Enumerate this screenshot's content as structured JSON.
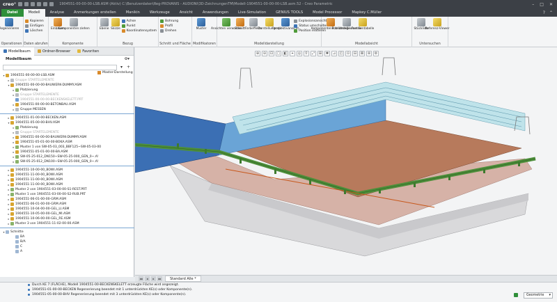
{
  "titlebar": {
    "logo": "creo°",
    "title": "1904551-00-00-00-LSB.ASM (Aktiv) C:\\Benutzerdaten\\Reg-PROVANIS - AUDIONI\\3D-ZeichnungenTM\\Modell-1904551-00-00-00-LSB.asm.52 - Creo Parametric",
    "controls": [
      "–",
      "□",
      "✕"
    ]
  },
  "tabs": [
    "Datei",
    "Modell",
    "Analyse",
    "Anmerkungen erstellen",
    "Manikin",
    "Werkzeuge",
    "Ansicht",
    "Anwendungen",
    "Live-Simulation",
    "GENIUS TOOLS",
    "Model Processor",
    "Mapkey C.Müller"
  ],
  "ribbon_groups": [
    {
      "label": "Operationen",
      "buttons": [
        "Regenerieren"
      ],
      "small": []
    },
    {
      "label": "Daten abrufen",
      "buttons": [],
      "small": [
        "Kopieren",
        "Einfügen",
        "Löschen"
      ]
    },
    {
      "label": "Komponente",
      "buttons": [
        "Einbauen",
        "Komponenten ziehen"
      ],
      "small": []
    },
    {
      "label": "Bezug",
      "buttons": [
        "Ebene",
        "Skizze"
      ],
      "small": [
        "Achse",
        "Punkt",
        "Koordinatensystem"
      ]
    },
    {
      "label": "Schnitt und Fläche",
      "buttons": [],
      "small": [
        "Bohrung",
        "Profil",
        "Drehen"
      ]
    },
    {
      "label": "Modifikatoren",
      "buttons": [
        "Muster"
      ],
      "small": []
    },
    {
      "label": "Modelldarstellung",
      "buttons": [
        "Ansichten verwalten",
        "Schnitt",
        "Farbeffekte",
        "Darstellungsstil",
        "Perspektivansicht"
      ],
      "small": [
        "Explosionsansicht",
        "Status umschalten",
        "Position editieren"
      ]
    },
    {
      "label": "Modellabsicht",
      "buttons": [
        "Komponentenschnittstelle",
        "Publizieregeometrie",
        "Familientabelle"
      ],
      "small": []
    },
    {
      "label": "Untersuchen",
      "buttons": [
        "Stückliste",
        "Referenz-Viewer"
      ],
      "small": []
    }
  ],
  "panel": {
    "tabs": [
      "Modellbaum",
      "Ordner-Browser",
      "Favoriten"
    ],
    "title": "Modellbaum",
    "search_placeholder": "",
    "column_header": "Master-Darstellung"
  },
  "tree": [
    {
      "text": "1904551-00-00-00-LSB.ASM",
      "icon": "asm",
      "indent": 0,
      "exp": "▾",
      "dim": false,
      "sel": false
    },
    {
      "text": "Gruppe STARTELEMENTE",
      "icon": "grp",
      "indent": 1,
      "exp": "▸",
      "dim": true,
      "sel": false
    },
    {
      "text": "1904551-00-00-00-BAUWERK-DUMMY.ASM",
      "icon": "asm",
      "indent": 1,
      "exp": "▾",
      "dim": false,
      "sel": false
    },
    {
      "text": "Platzierung",
      "icon": "feat",
      "indent": 2,
      "exp": "▸",
      "dim": false,
      "sel": false
    },
    {
      "text": "Gruppe STARTELEMENTE",
      "icon": "grp",
      "indent": 2,
      "exp": "▸",
      "dim": true,
      "sel": false
    },
    {
      "text": "1904551-00-00-00-BECKENSKELETT.PRT",
      "icon": "prt",
      "indent": 2,
      "exp": "",
      "dim": true,
      "sel": false
    },
    {
      "text": "1904551-00-00-00-BETONBAU.ASM",
      "icon": "asm",
      "indent": 2,
      "exp": "▸",
      "dim": false,
      "sel": false
    },
    {
      "text": "Gruppe MESSEN",
      "icon": "grp",
      "indent": 2,
      "exp": "▸",
      "dim": false,
      "sel": false
    },
    {
      "text": "sep",
      "icon": "",
      "indent": 0,
      "exp": "",
      "dim": false,
      "sel": false
    },
    {
      "text": "1904551-01-00-00-BECKEN.ASM",
      "icon": "asm",
      "indent": 1,
      "exp": "▸",
      "dim": false,
      "sel": false
    },
    {
      "text": "1904551-05-00-00-BHV.ASM",
      "icon": "asm",
      "indent": 1,
      "exp": "▾",
      "dim": false,
      "sel": false
    },
    {
      "text": "Platzierung",
      "icon": "feat",
      "indent": 2,
      "exp": "▸",
      "dim": false,
      "sel": false
    },
    {
      "text": "Gruppe STARTELEMENTE",
      "icon": "grp",
      "indent": 2,
      "exp": "▸",
      "dim": true,
      "sel": false
    },
    {
      "text": "1904551-00-00-00-BAUWERK-DUMMY.ASM",
      "icon": "asm",
      "indent": 2,
      "exp": "▸",
      "dim": false,
      "sel": false
    },
    {
      "text": "1904551-05-01-00-00-BOKA.ASM",
      "icon": "asm",
      "indent": 2,
      "exp": "▸",
      "dim": false,
      "sel": false
    },
    {
      "text": "Muster 1 von SW-05-03_003_BBF125~SW-05-03-00",
      "icon": "feat",
      "indent": 2,
      "exp": "▸",
      "dim": false,
      "sel": false
    },
    {
      "text": "1904551-05-01-00-00-BA.ASM",
      "icon": "asm",
      "indent": 2,
      "exp": "▸",
      "dim": false,
      "sel": false
    },
    {
      "text": "SW-05-25-012_DN150~SW-05-25-000_GEN_0~.A!",
      "icon": "feat",
      "indent": 2,
      "exp": "▸",
      "dim": false,
      "sel": false
    },
    {
      "text": "SW-05-25-012_DN100~SW-05-25-000_GEN_0~.A!",
      "icon": "feat",
      "indent": 2,
      "exp": "▸",
      "dim": false,
      "sel": false
    },
    {
      "text": "sep",
      "icon": "",
      "indent": 0,
      "exp": "",
      "dim": false,
      "sel": false
    },
    {
      "text": "1904551-10-00-00_BOWI.ASM",
      "icon": "asm",
      "indent": 1,
      "exp": "▸",
      "dim": false,
      "sel": false
    },
    {
      "text": "1904551-11-00-00_BOWI.ASM",
      "icon": "asm",
      "indent": 1,
      "exp": "▸",
      "dim": false,
      "sel": false
    },
    {
      "text": "1904551-11-00-00_BOWI.ASM",
      "icon": "asm",
      "indent": 1,
      "exp": "▸",
      "dim": false,
      "sel": false
    },
    {
      "text": "1904551-11-00-00_BOWI.ASM",
      "icon": "asm",
      "indent": 1,
      "exp": "▸",
      "dim": false,
      "sel": false
    },
    {
      "text": "Muster 2 von 1904551-03-00-00-S1-REST.PRT",
      "icon": "feat",
      "indent": 1,
      "exp": "▸",
      "dim": false,
      "sel": false
    },
    {
      "text": "Muster 1 von 1904551-03-00-00-S2-RUB.PRT",
      "icon": "feat",
      "indent": 1,
      "exp": "▸",
      "dim": false,
      "sel": false
    },
    {
      "text": "1904551-06-01-00-00-GRM.ASM",
      "icon": "asm",
      "indent": 1,
      "exp": "▸",
      "dim": false,
      "sel": false
    },
    {
      "text": "1904551-06-01-00-00-GRM.ASM",
      "icon": "asm",
      "indent": 1,
      "exp": "▸",
      "dim": false,
      "sel": false
    },
    {
      "text": "1904551-10-04-00-00-GEL_LI.ASM",
      "icon": "asm",
      "indent": 1,
      "exp": "▸",
      "dim": false,
      "sel": false
    },
    {
      "text": "1904551-10-05-00-00-GEL_MI.ASM",
      "icon": "asm",
      "indent": 1,
      "exp": "▸",
      "dim": false,
      "sel": false
    },
    {
      "text": "1904551-10-06-00-00-GEL_RE.ASM",
      "icon": "asm",
      "indent": 1,
      "exp": "▸",
      "dim": false,
      "sel": false
    },
    {
      "text": "Muster 3 von 1904551-11-02-00-00.ASM",
      "icon": "feat",
      "indent": 1,
      "exp": "▸",
      "dim": false,
      "sel": false
    },
    {
      "text": "sep",
      "icon": "",
      "indent": 0,
      "exp": "",
      "dim": false,
      "sel": false
    },
    {
      "text": "Schnitte",
      "icon": "sec",
      "indent": 0,
      "exp": "▾",
      "dim": false,
      "sel": false
    },
    {
      "text": "BA",
      "icon": "sec",
      "indent": 2,
      "exp": "",
      "dim": false,
      "sel": false
    },
    {
      "text": "B/A",
      "icon": "sec",
      "indent": 2,
      "exp": "",
      "dim": false,
      "sel": false
    },
    {
      "text": "C",
      "icon": "sec",
      "indent": 2,
      "exp": "",
      "dim": false,
      "sel": false
    },
    {
      "text": "A",
      "icon": "sec",
      "indent": 2,
      "exp": "",
      "dim": false,
      "sel": false
    }
  ],
  "view_toolbar_icons": [
    "⊕",
    "⊖",
    "⊡",
    "▢",
    "◧",
    "⌖",
    "◎",
    "⚲",
    "⤢",
    "⊞",
    "✱",
    "⊿",
    "◰",
    "⊙",
    "⊟",
    "⊠",
    "⊛",
    "⚙"
  ],
  "window_tab": "Standard Alle *",
  "messages": [
    "Durch KE 7 (FLÄCHE), Modell 1904551-00-BECKENSKELETT erzeugte Fläche wird angezeigt.",
    "1904551-01-00-00-BECKEN Regenerierung beendet mit 1 unterdrückten KE(s) oder Komponente(n).",
    "1904551-05-00-00-BHV Regenerierung beendet mit 3 unterdrückten KE(s) oder Komponente(n)."
  ],
  "selection_filter": "Geometrie",
  "colors": {
    "file_tab": "#2f8f3a",
    "accent": "#2d6db5",
    "viewport_bg": "#f3f4f5"
  }
}
